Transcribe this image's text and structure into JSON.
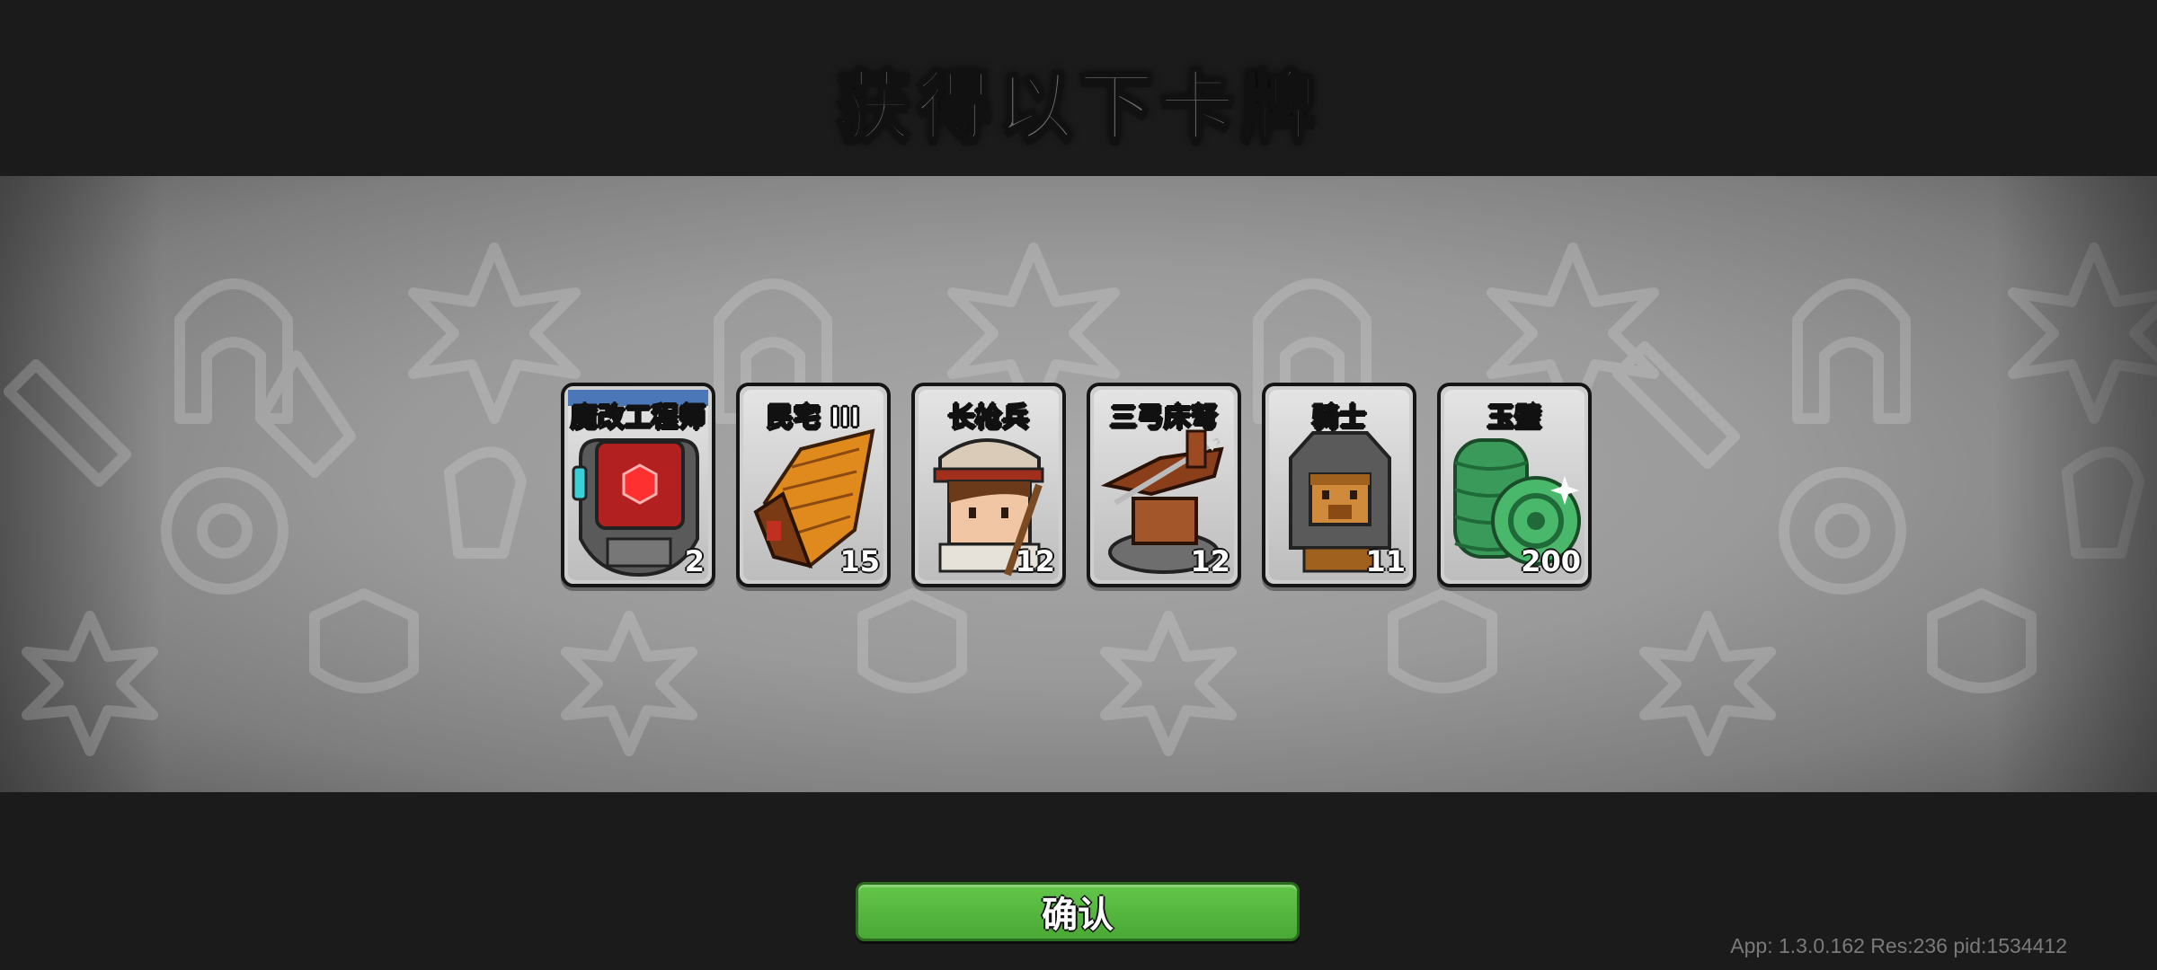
{
  "title": "获得以下卡牌",
  "cards": [
    {
      "name": "魔改工程师",
      "count": "2",
      "icon": "mech-engineer-icon"
    },
    {
      "name": "民宅 III",
      "count": "15",
      "icon": "house-icon"
    },
    {
      "name": "长枪兵",
      "count": "12",
      "icon": "spearman-icon"
    },
    {
      "name": "三弓床弩",
      "count": "12",
      "icon": "ballista-icon"
    },
    {
      "name": "骑士",
      "count": "11",
      "icon": "knight-icon"
    },
    {
      "name": "玉璧",
      "count": "200",
      "icon": "jade-coins-icon"
    }
  ],
  "confirm_label": "确认",
  "version_text": "App: 1.3.0.162 Res:236 pid:1534412",
  "colors": {
    "background": "#1b1b1b",
    "banner": "#9a9a9a",
    "button": "#55b63f",
    "card_border": "#151515"
  }
}
